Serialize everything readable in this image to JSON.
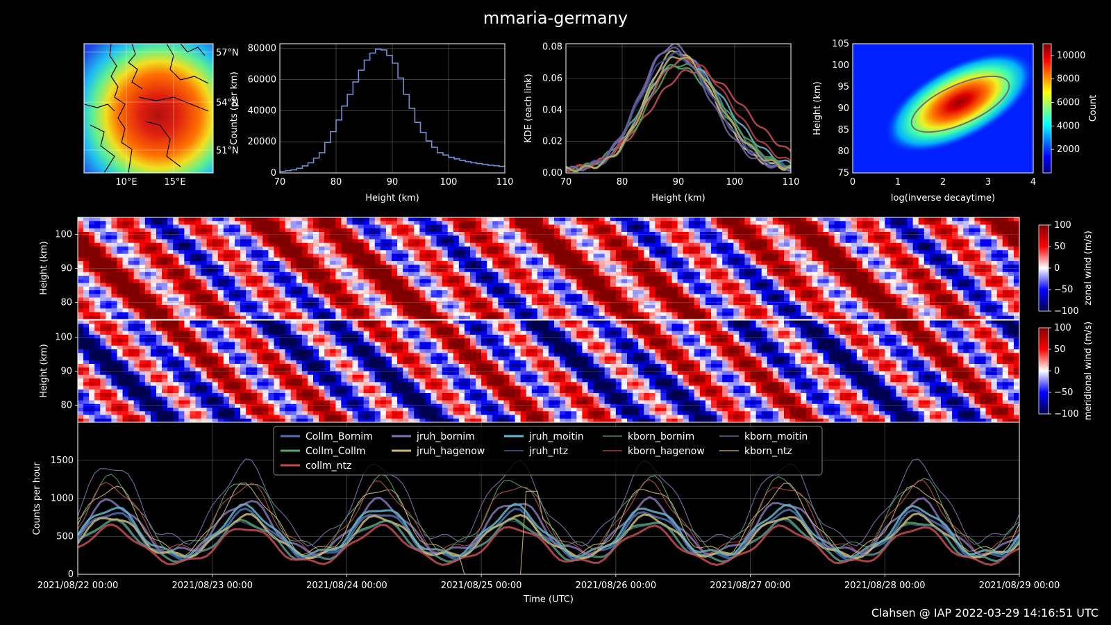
{
  "figure": {
    "title": "mmaria-germany",
    "credit": "Clahsen @ IAP 2022-03-29 14:16:51 UTC"
  },
  "colors": {
    "background": "#000000",
    "hist_line": "#6f8fd8",
    "ellipse": "#707070"
  },
  "chart_data": [
    {
      "id": "map",
      "type": "heatmap",
      "description_colormap": "jet",
      "xticks": [
        "10°E",
        "15°E"
      ],
      "yticks": [
        "57°N",
        "54°N",
        "51°N"
      ]
    },
    {
      "id": "height_histogram",
      "type": "line",
      "title": "",
      "xlabel": "Height (km)",
      "ylabel": "Counts (per km)",
      "xlim": [
        70,
        110
      ],
      "ylim": [
        0,
        83000
      ],
      "xticks": [
        "70",
        "80",
        "90",
        "100",
        "110"
      ],
      "yticks": [
        "0",
        "20000",
        "40000",
        "60000",
        "80000"
      ],
      "x": [
        70,
        71,
        72,
        73,
        74,
        75,
        76,
        77,
        78,
        79,
        80,
        81,
        82,
        83,
        84,
        85,
        86,
        87,
        88,
        89,
        90,
        91,
        92,
        93,
        94,
        95,
        96,
        97,
        98,
        99,
        100,
        101,
        102,
        103,
        104,
        105,
        106,
        107,
        108,
        109
      ],
      "values": [
        1000,
        1500,
        2000,
        3000,
        4500,
        6500,
        9500,
        13000,
        19500,
        26500,
        34000,
        43000,
        50500,
        58500,
        66000,
        72500,
        77000,
        79500,
        79000,
        75500,
        70500,
        61000,
        50500,
        41500,
        32500,
        26000,
        20500,
        16500,
        13000,
        11500,
        10000,
        9000,
        8000,
        7200,
        6500,
        6000,
        5500,
        5000,
        4600,
        4200
      ],
      "grid": true
    },
    {
      "id": "kde_each_link",
      "type": "line",
      "xlabel": "Height (km)",
      "ylabel": "KDE (each link)",
      "xlim": [
        70,
        110
      ],
      "ylim": [
        0,
        0.082
      ],
      "xticks": [
        "70",
        "80",
        "90",
        "100",
        "110"
      ],
      "yticks": [
        "0.00",
        "0.02",
        "0.04",
        "0.06",
        "0.08"
      ],
      "series": [
        {
          "color": "#4c72b0",
          "mu": 90,
          "sigma": 5.8,
          "peak": 0.074
        },
        {
          "color": "#55a868",
          "mu": 89.5,
          "sigma": 6.2,
          "peak": 0.066
        },
        {
          "color": "#c44e52",
          "mu": 92.5,
          "sigma": 7.5,
          "peak": 0.063
        },
        {
          "color": "#8172b2",
          "mu": 89,
          "sigma": 5.6,
          "peak": 0.079
        },
        {
          "color": "#ccb974",
          "mu": 89.5,
          "sigma": 5.4,
          "peak": 0.075
        },
        {
          "color": "#64b5cd",
          "mu": 90.5,
          "sigma": 6.4,
          "peak": 0.069
        },
        {
          "color": "#2e4e8e",
          "mu": 89,
          "sigma": 5.9,
          "peak": 0.073
        },
        {
          "color": "#4e9e58",
          "mu": 90.5,
          "sigma": 6.0,
          "peak": 0.067
        },
        {
          "color": "#b04040",
          "mu": 91,
          "sigma": 6.6,
          "peak": 0.07
        },
        {
          "color": "#7262a2",
          "mu": 88.5,
          "sigma": 5.5,
          "peak": 0.077
        },
        {
          "color": "#bba964",
          "mu": 90,
          "sigma": 5.7,
          "peak": 0.072
        }
      ],
      "grid": true
    },
    {
      "id": "decaytime_height",
      "type": "heatmap",
      "xlabel": "log(inverse decaytime)",
      "ylabel": "Height (km)",
      "xlim": [
        0,
        4
      ],
      "ylim": [
        75,
        105
      ],
      "xticks": [
        "0",
        "1",
        "2",
        "3",
        "4"
      ],
      "yticks": [
        "75",
        "80",
        "85",
        "90",
        "95",
        "100",
        "105"
      ],
      "colorbar_label": "Count",
      "colorbar_ticks": [
        "2000",
        "4000",
        "6000",
        "8000",
        "10000"
      ],
      "colorbar_range": [
        0,
        11000
      ],
      "peak": {
        "x": 2.4,
        "y": 91
      }
    },
    {
      "id": "zonal_wind",
      "type": "heatmap",
      "ylabel": "Height (km)",
      "yticks": [
        "80",
        "90",
        "100"
      ],
      "colorbar_label": "zonal wind (m/s)",
      "colorbar_ticks": [
        "100",
        "50",
        "0",
        "−50",
        "−100"
      ],
      "colorbar_range": [
        -100,
        100
      ],
      "colormap": "seismic"
    },
    {
      "id": "meridional_wind",
      "type": "heatmap",
      "ylabel": "Height (km)",
      "yticks": [
        "80",
        "90",
        "100"
      ],
      "colorbar_label": "meridional wind (m/s)",
      "colorbar_ticks": [
        "100",
        "50",
        "0",
        "−50",
        "−100"
      ],
      "colorbar_range": [
        -100,
        100
      ],
      "colormap": "seismic"
    },
    {
      "id": "counts_per_hour",
      "type": "line",
      "xlabel": "Time (UTC)",
      "ylabel": "Counts per hour",
      "ylim": [
        0,
        2000
      ],
      "yticks": [
        "0",
        "500",
        "1000",
        "1500"
      ],
      "xticks": [
        "2021/08/22 00:00",
        "2021/08/23 00:00",
        "2021/08/24 00:00",
        "2021/08/25 00:00",
        "2021/08/26 00:00",
        "2021/08/27 00:00",
        "2021/08/28 00:00",
        "2021/08/29 00:00"
      ],
      "x_range_days": [
        0,
        7
      ],
      "legend_position": "top-center",
      "series": [
        {
          "name": "Collm_Bornim",
          "color": "#4c72b0",
          "width": 3,
          "peak": 820,
          "trough": 230
        },
        {
          "name": "Collm_Collm",
          "color": "#55a868",
          "width": 3,
          "peak": 700,
          "trough": 200
        },
        {
          "name": "collm_ntz",
          "color": "#c44e52",
          "width": 3,
          "peak": 620,
          "trough": 160
        },
        {
          "name": "jruh_bornim",
          "color": "#8172b2",
          "width": 3,
          "peak": 960,
          "trough": 300
        },
        {
          "name": "jruh_hagenow",
          "color": "#ccb974",
          "width": 3,
          "peak": 760,
          "trough": 250
        },
        {
          "name": "jruh_moitin",
          "color": "#64b5cd",
          "width": 3,
          "peak": 880,
          "trough": 270
        },
        {
          "name": "jruh_ntz",
          "color": "#4c72b0",
          "width": 1.2,
          "peak": 680,
          "trough": 210
        },
        {
          "name": "kborn_bornim",
          "color": "#55a868",
          "width": 1.2,
          "peak": 1250,
          "trough": 360
        },
        {
          "name": "kborn_hagenow",
          "color": "#c44e52",
          "width": 1.2,
          "peak": 1180,
          "trough": 330
        },
        {
          "name": "kborn_moitin",
          "color": "#8172b2",
          "width": 1.2,
          "peak": 1450,
          "trough": 450
        },
        {
          "name": "kborn_ntz",
          "color": "#ccb974",
          "width": 1.2,
          "peak": 1150,
          "trough": 300
        }
      ],
      "grid": true
    }
  ]
}
